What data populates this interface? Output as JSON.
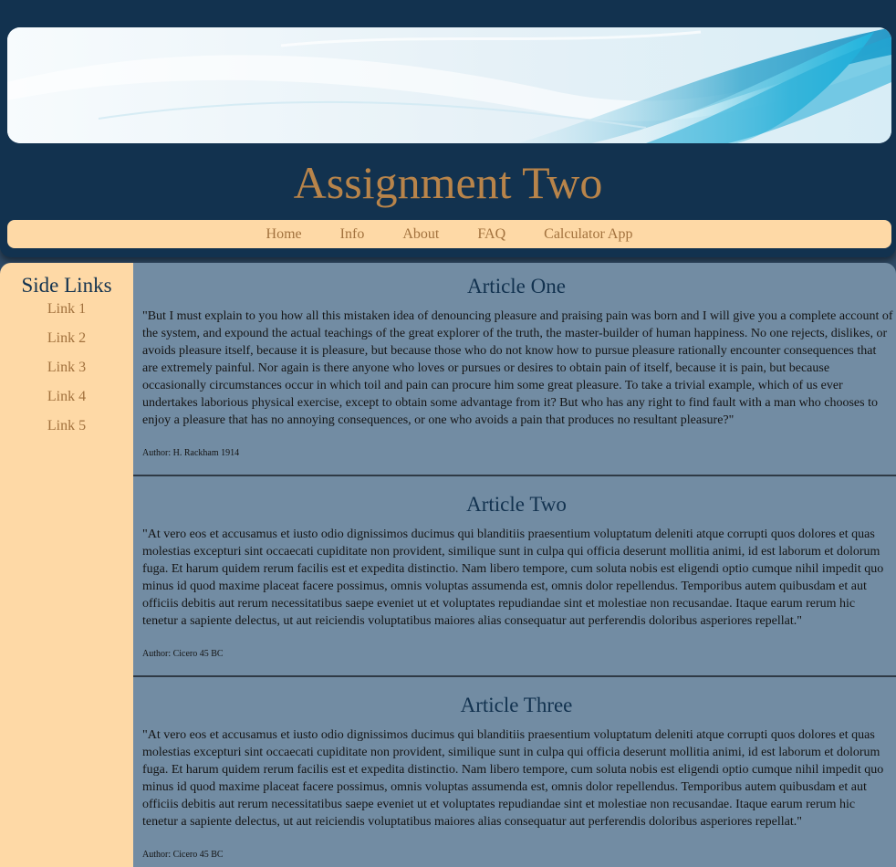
{
  "header": {
    "title": "Assignment Two"
  },
  "nav": {
    "items": [
      {
        "label": "Home"
      },
      {
        "label": "Info"
      },
      {
        "label": "About"
      },
      {
        "label": "FAQ"
      },
      {
        "label": "Calculator App"
      }
    ]
  },
  "sidebar": {
    "title": "Side Links",
    "links": [
      {
        "label": "Link 1"
      },
      {
        "label": "Link 2"
      },
      {
        "label": "Link 3"
      },
      {
        "label": "Link 4"
      },
      {
        "label": "Link 5"
      }
    ]
  },
  "articles": [
    {
      "title": "Article One",
      "body": "\"But I must explain to you how all this mistaken idea of denouncing pleasure and praising pain was born and I will give you a complete account of the system, and expound the actual teachings of the great explorer of the truth, the master-builder of human happiness. No one rejects, dislikes, or avoids pleasure itself, because it is pleasure, but because those who do not know how to pursue pleasure rationally encounter consequences that are extremely painful. Nor again is there anyone who loves or pursues or desires to obtain pain of itself, because it is pain, but because occasionally circumstances occur in which toil and pain can procure him some great pleasure. To take a trivial example, which of us ever undertakes laborious physical exercise, except to obtain some advantage from it? But who has any right to find fault with a man who chooses to enjoy a pleasure that has no annoying consequences, or one who avoids a pain that produces no resultant pleasure?\"",
      "author": "Author: H. Rackham  1914"
    },
    {
      "title": "Article Two",
      "body": "\"At vero eos et accusamus et iusto odio dignissimos ducimus qui blanditiis praesentium voluptatum deleniti atque corrupti quos dolores et quas molestias excepturi sint occaecati cupiditate non provident, similique sunt in culpa qui officia deserunt mollitia animi, id est laborum et dolorum fuga. Et harum quidem rerum facilis est et expedita distinctio. Nam libero tempore, cum soluta nobis est eligendi optio cumque nihil impedit quo minus id quod maxime placeat facere possimus, omnis voluptas assumenda est, omnis dolor repellendus. Temporibus autem quibusdam et aut officiis debitis aut rerum necessitatibus saepe eveniet ut et voluptates repudiandae sint et molestiae non recusandae. Itaque earum rerum hic tenetur a sapiente delectus, ut aut reiciendis voluptatibus maiores alias consequatur aut perferendis doloribus asperiores repellat.\"",
      "author": "Author: Cicero  45 BC"
    },
    {
      "title": "Article Three",
      "body": "\"At vero eos et accusamus et iusto odio dignissimos ducimus qui blanditiis praesentium voluptatum deleniti atque corrupti quos dolores et quas molestias excepturi sint occaecati cupiditate non provident, similique sunt in culpa qui officia deserunt mollitia animi, id est laborum et dolorum fuga. Et harum quidem rerum facilis est et expedita distinctio. Nam libero tempore, cum soluta nobis est eligendi optio cumque nihil impedit quo minus id quod maxime placeat facere possimus, omnis voluptas assumenda est, omnis dolor repellendus. Temporibus autem quibusdam et aut officiis debitis aut rerum necessitatibus saepe eveniet ut et voluptates repudiandae sint et molestiae non recusandae. Itaque earum rerum hic tenetur a sapiente delectus, ut aut reiciendis voluptatibus maiores alias consequatur aut perferendis doloribus asperiores repellat.\"",
      "author": "Author: Cicero  45 BC"
    }
  ],
  "colors": {
    "header_bg": "#12324f",
    "title": "#b8844a",
    "nav_bg": "#fed9a6",
    "link": "#a2723e",
    "main_bg": "#728ca3",
    "heading": "#12324f"
  }
}
